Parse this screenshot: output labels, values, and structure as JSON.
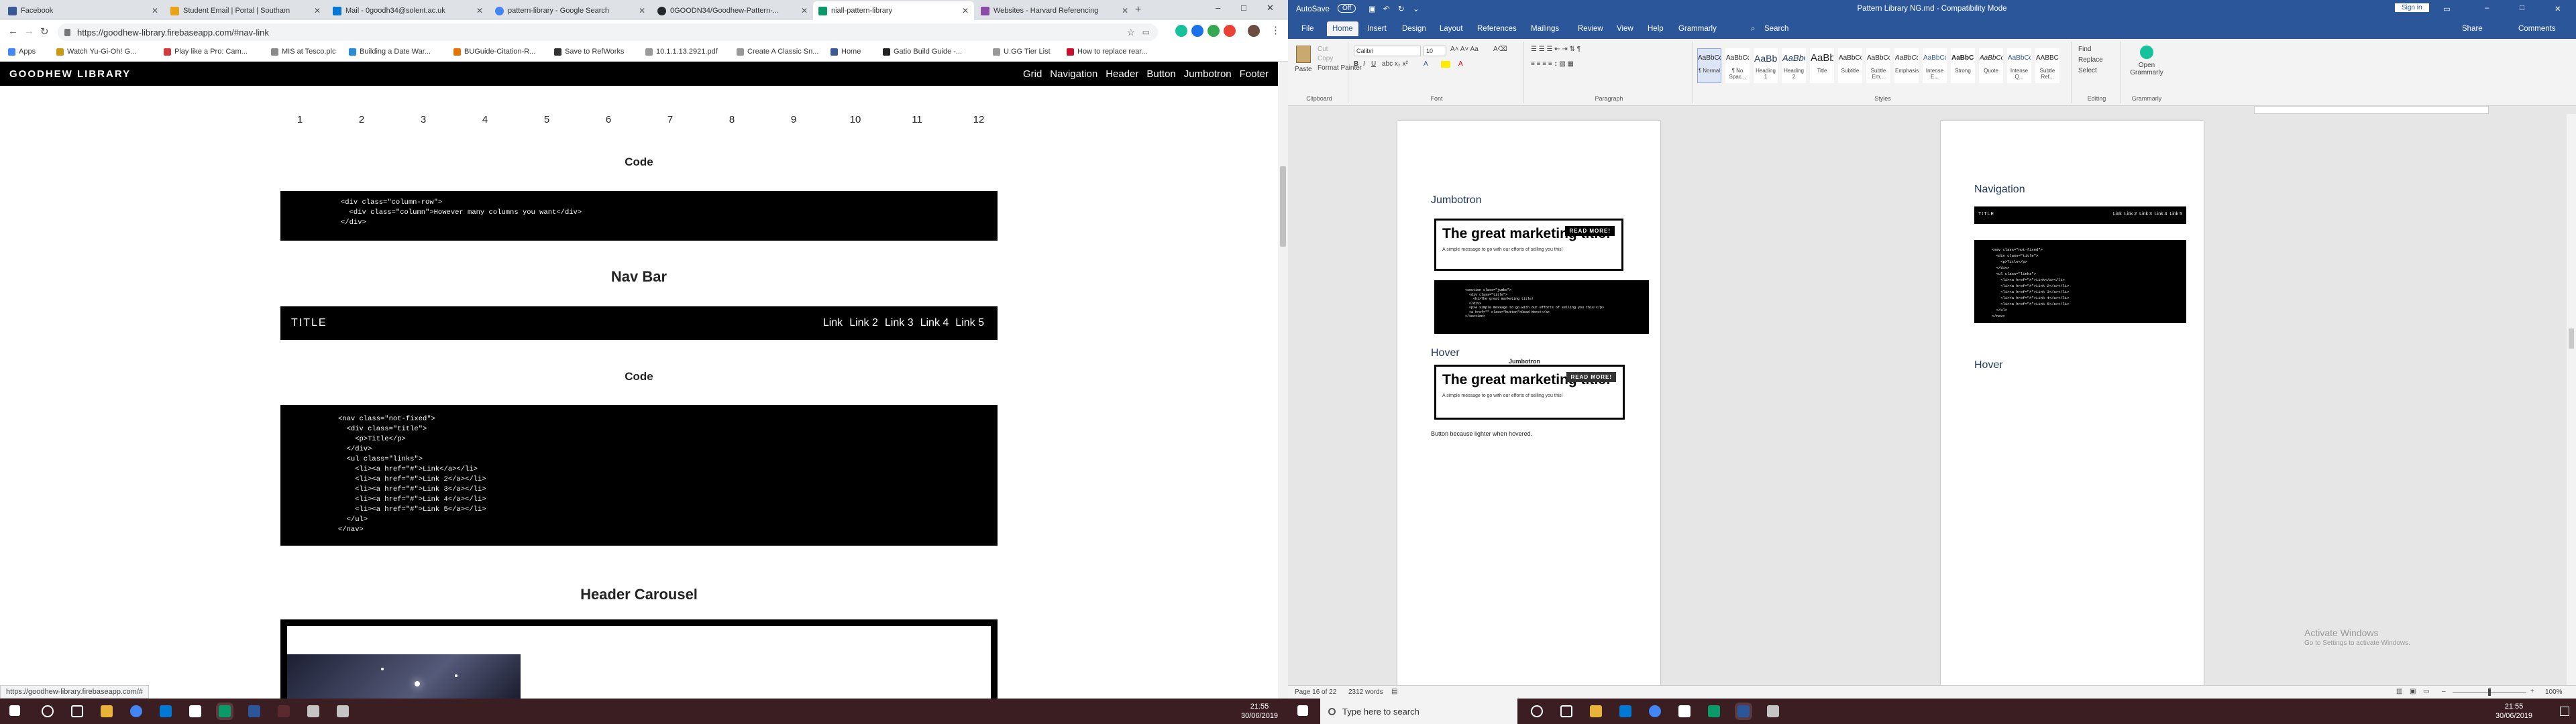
{
  "browser": {
    "tabs": [
      {
        "title": "Facebook",
        "color": "#3b5998"
      },
      {
        "title": "Student Email | Portal | Southam",
        "color": "#e8a317"
      },
      {
        "title": "Mail - 0goodh34@solent.ac.uk",
        "color": "#0078d4"
      },
      {
        "title": "pattern-library - Google Search",
        "color": "#4285f4"
      },
      {
        "title": "0GOODN34/Goodhew-Pattern-...",
        "color": "#24292e"
      },
      {
        "title": "niall-pattern-library",
        "color": "#0a9a6a"
      },
      {
        "title": "Websites - Harvard Referencing",
        "color": "#8b4aa8"
      }
    ],
    "new_tab": "+",
    "window_controls": [
      "–",
      "□",
      "✕"
    ],
    "url": "https://goodhew-library.firebaseapp.com/#nav-link",
    "bookmarks": [
      "Apps",
      "Watch Yu-Gi-Oh! G...",
      "Play like a Pro: Cam...",
      "MIS at Tesco.plc",
      "Building a Date War...",
      "BUGuide-Citation-R...",
      "Save to RefWorks",
      "10.1.1.13.2921.pdf",
      "Create A Classic Sn...",
      "Home",
      "Gatio Build Guide -...",
      "U.GG Tier List",
      "How to replace rear..."
    ],
    "status_url": "https://goodhew-library.firebaseapp.com/#"
  },
  "library": {
    "brand": "GOODHEW LIBRARY",
    "nav": [
      "Grid",
      "Navigation",
      "Header",
      "Button",
      "Jumbotron",
      "Footer"
    ],
    "grid_numbers": [
      "1",
      "2",
      "3",
      "4",
      "5",
      "6",
      "7",
      "8",
      "9",
      "10",
      "11",
      "12"
    ],
    "code_heading_1": "Code",
    "grid_code": "<div class=\"column-row\">\n  <div class=\"column\">However many columns you want</div>\n</div>",
    "navbar_heading": "Nav Bar",
    "demo_nav": {
      "title": "TITLE",
      "links": [
        "Link",
        "Link 2",
        "Link 3",
        "Link 4",
        "Link 5"
      ]
    },
    "code_heading_2": "Code",
    "nav_code": "<nav class=\"not-fixed\">\n  <div class=\"title\">\n    <p>Title</p>\n  </div>\n  <ul class=\"links\">\n    <li><a href=\"#\">Link</a></li>\n    <li><a href=\"#\">Link 2</a></li>\n    <li><a href=\"#\">Link 3</a></li>\n    <li><a href=\"#\">Link 4</a></li>\n    <li><a href=\"#\">Link 5</a></li>\n  </ul>\n</nav>",
    "carousel_heading": "Header Carousel"
  },
  "taskbar_left": {
    "time": "21:55",
    "date": "30/06/2019"
  },
  "word": {
    "autosave": "AutoSave",
    "autosave_state": "Off",
    "doc_title": "Pattern Library NG.md  -  Compatibility Mode",
    "sign_in": "Sign in",
    "menu": [
      "File",
      "Home",
      "Insert",
      "Design",
      "Layout",
      "References",
      "Mailings",
      "Review",
      "View",
      "Help",
      "Grammarly"
    ],
    "search": "Search",
    "share": "Share",
    "comments": "Comments",
    "clipboard": {
      "paste": "Paste",
      "cut": "Cut",
      "copy": "Copy",
      "painter": "Format Painter",
      "label": "Clipboard"
    },
    "font": {
      "name": "Calibri",
      "size": "10",
      "label": "Font"
    },
    "paragraph_label": "Paragraph",
    "styles": [
      {
        "preview": "AaBbCcDdE",
        "name": "¶ Normal"
      },
      {
        "preview": "AaBbCcDdE",
        "name": "¶ No Spac..."
      },
      {
        "preview": "AaBbC",
        "name": "Heading 1"
      },
      {
        "preview": "AaBbCc",
        "name": "Heading 2"
      },
      {
        "preview": "AaBbC",
        "name": "Title"
      },
      {
        "preview": "AaBbCcD",
        "name": "Subtitle"
      },
      {
        "preview": "AaBbCcDdE",
        "name": "Subtle Em..."
      },
      {
        "preview": "AaBbCcDdE",
        "name": "Emphasis"
      },
      {
        "preview": "AaBbCcDdE",
        "name": "Intense E..."
      },
      {
        "preview": "AaBbCcDdE",
        "name": "Strong"
      },
      {
        "preview": "AaBbCcDdE",
        "name": "Quote"
      },
      {
        "preview": "AaBbCcDdE",
        "name": "Intense Q..."
      },
      {
        "preview": "AABBCCDDE",
        "name": "Subtle Ref..."
      }
    ],
    "styles_label": "Styles",
    "editing": {
      "find": "Find",
      "replace": "Replace",
      "select": "Select",
      "label": "Editing"
    },
    "grammarly": {
      "open": "Open Grammarly",
      "label": "Grammarly"
    },
    "page1": {
      "heading_jumbotron": "Jumbotron",
      "jumbo_title": "The great marketing title!",
      "jumbo_sub": "A simple message to go with our efforts of selling you this!",
      "jumbo_btn": "READ MORE!",
      "jumbo_code": "<section class=\"jumbo\">\n  <div class=\"title\">\n    <h1>The great marketing title!\n  </div>\n  <p>A simple message to go with our efforts of selling you this!</p>\n  <a href=\"\" class=\"button\">Read More!</a>\n</section>",
      "heading_hover": "Hover",
      "jumbo_caption": "Jumbotron",
      "hover_note": "Button because lighter when hovered."
    },
    "page2": {
      "heading_navigation": "Navigation",
      "nav_title": "TITLE",
      "nav_links": "Link  Link 2  Link 3  Link 4  Link 5",
      "nav_code": "<nav class=\"not-fixed\">\n  <div class=\"title\">\n    <p>Title</p>\n  </div>\n  <ul class=\"links\">\n    <li><a href=\"#\">Link</a></li>\n    <li><a href=\"#\">Link 2</a></li>\n    <li><a href=\"#\">Link 3</a></li>\n    <li><a href=\"#\">Link 4</a></li>\n    <li><a href=\"#\">Link 5</a></li>\n  </ul>\n</nav>",
      "heading_hover": "Hover"
    },
    "status": {
      "page": "Page 16 of 22",
      "words": "2312 words",
      "zoom": "100%"
    },
    "activate_title": "Activate Windows",
    "activate_sub": "Go to Settings to activate Windows."
  },
  "taskbar_right": {
    "search_placeholder": "Type here to search",
    "time": "21:55",
    "date": "30/06/2019"
  },
  "colors": {
    "word_blue": "#2b579a",
    "taskbar": "#3b1e22",
    "chrome_strip": "#dee1e6"
  }
}
